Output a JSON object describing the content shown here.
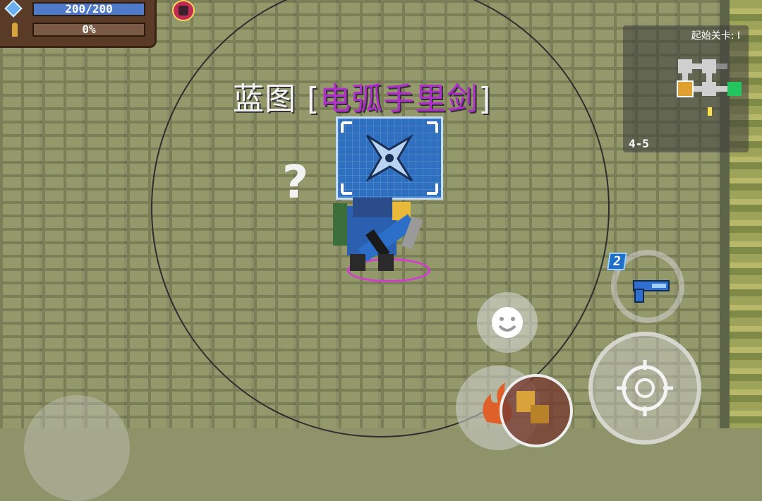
{
  "hud": {
    "energy_text": "200/200",
    "progress_text": "0%"
  },
  "minimap": {
    "title": "起始关卡: I",
    "level": "4-5"
  },
  "blueprint": {
    "prefix": "蓝图 [",
    "item_name": "电弧手里剑",
    "suffix": "]"
  },
  "hint": "?",
  "weapon_swap": {
    "ammo_count": "2"
  },
  "colors": {
    "energy": "#4f79c9",
    "blueprint_name": "#b02ec9",
    "minimap_start": "#e0a030",
    "minimap_exit": "#22c55e"
  }
}
